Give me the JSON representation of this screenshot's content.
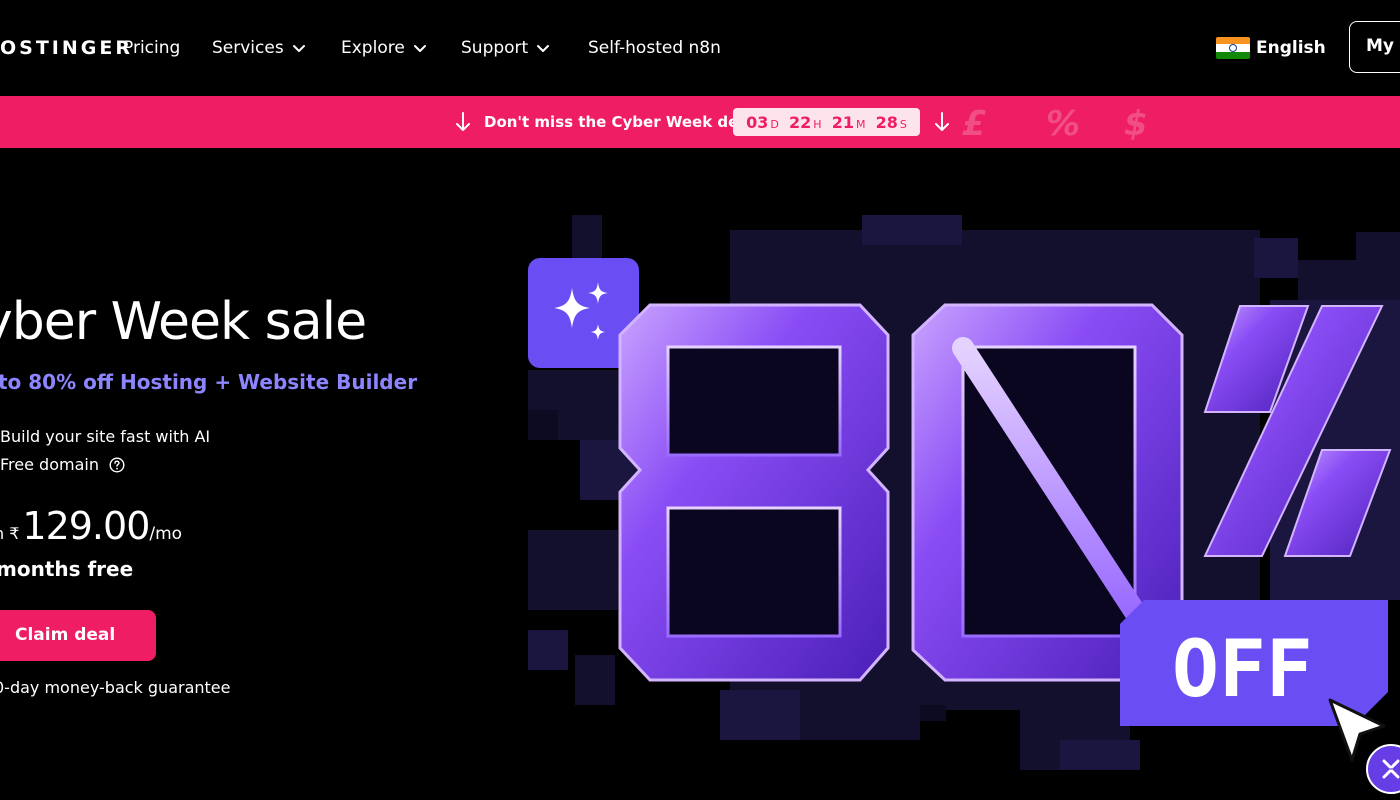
{
  "nav": {
    "logo": "OSTINGER",
    "items": [
      {
        "label": "Pricing"
      },
      {
        "label": "Services",
        "has_dropdown": true
      },
      {
        "label": "Explore",
        "has_dropdown": true
      },
      {
        "label": "Support",
        "has_dropdown": true
      },
      {
        "label": "Self-hosted n8n"
      }
    ],
    "language": "English",
    "language_flag": "india-flag-icon",
    "account_label": "My a"
  },
  "promo": {
    "text": "Don't miss the Cyber Week deals",
    "countdown": [
      {
        "value": "03",
        "unit": "D"
      },
      {
        "value": "22",
        "unit": "H"
      },
      {
        "value": "21",
        "unit": "M"
      },
      {
        "value": "28",
        "unit": "S"
      }
    ],
    "decor_glyphs": [
      "£",
      "%",
      "$"
    ],
    "colors": {
      "bar": "#ee1d64",
      "timer_bg": "#fde4ec"
    }
  },
  "hero": {
    "title": "yber Week sale",
    "subtitle": "to 80% off Hosting + Website Builder",
    "features": [
      {
        "text": "Build your site fast with AI"
      },
      {
        "text": "Free domain",
        "has_info_icon": true
      }
    ],
    "price_prefix": "n ₹",
    "price": "129.00",
    "price_period": "/mo",
    "months_free": "months free",
    "cta": "Claim deal",
    "guarantee": "0-day money-back guarantee",
    "colors": {
      "accent": "#ee1d64",
      "subtitle": "#8c85ff",
      "brand_purple": "#673de6"
    }
  },
  "graphic": {
    "discount": "80%",
    "off_label": "OFF",
    "icons": [
      "sparkle-icon",
      "cursor-arrow-icon",
      "chat-assistant-icon"
    ]
  }
}
